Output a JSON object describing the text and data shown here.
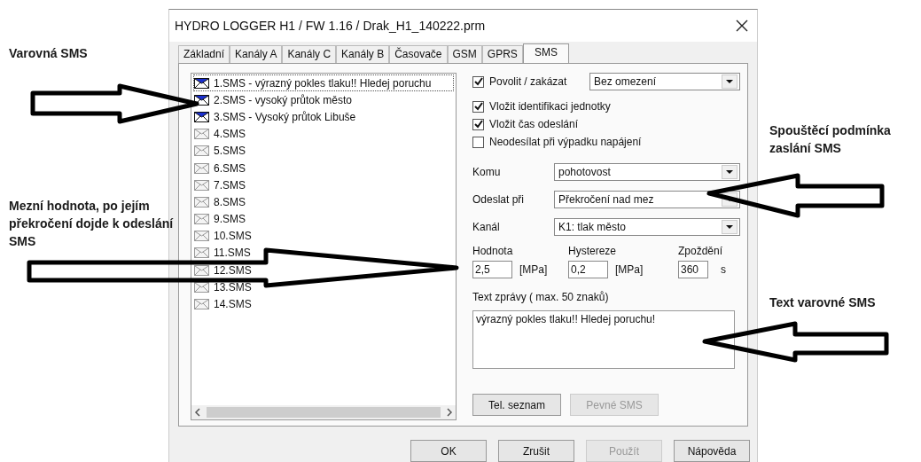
{
  "window": {
    "title": "HYDRO LOGGER H1 / FW 1.16 / Drak_H1_140222.prm"
  },
  "tabs": [
    {
      "label": "Základní",
      "selected": false
    },
    {
      "label": "Kanály A",
      "selected": false
    },
    {
      "label": "Kanály C",
      "selected": false
    },
    {
      "label": "Kanály B",
      "selected": false
    },
    {
      "label": "Časovače",
      "selected": false
    },
    {
      "label": "GSM",
      "selected": false
    },
    {
      "label": "GPRS",
      "selected": false
    },
    {
      "label": "SMS",
      "selected": true
    }
  ],
  "sms_list": [
    {
      "label": "1.SMS - výrazný pokles tlaku!! Hledej poruchu",
      "active": true,
      "selected": true
    },
    {
      "label": "2.SMS - vysoký průtok město",
      "active": true,
      "selected": false
    },
    {
      "label": "3.SMS -  Vysoký průtok Libuše",
      "active": true,
      "selected": false
    },
    {
      "label": "4.SMS",
      "active": false,
      "selected": false
    },
    {
      "label": "5.SMS",
      "active": false,
      "selected": false
    },
    {
      "label": "6.SMS",
      "active": false,
      "selected": false
    },
    {
      "label": "7.SMS",
      "active": false,
      "selected": false
    },
    {
      "label": "8.SMS",
      "active": false,
      "selected": false
    },
    {
      "label": "9.SMS",
      "active": false,
      "selected": false
    },
    {
      "label": "10.SMS",
      "active": false,
      "selected": false
    },
    {
      "label": "11.SMS",
      "active": false,
      "selected": false
    },
    {
      "label": "12.SMS",
      "active": false,
      "selected": false
    },
    {
      "label": "13.SMS",
      "active": false,
      "selected": false
    },
    {
      "label": "14.SMS",
      "active": false,
      "selected": false
    }
  ],
  "enable": {
    "label": "Povolit / zakázat",
    "checked": true,
    "value": "Bez omezení"
  },
  "options": [
    {
      "label": "Vložit identifikaci jednotky",
      "checked": true
    },
    {
      "label": "Vložit čas odeslání",
      "checked": true
    },
    {
      "label": "Neodesílat při výpadku napájení",
      "checked": false
    }
  ],
  "selects": [
    {
      "label": "Komu",
      "value": "pohotovost"
    },
    {
      "label": "Odeslat při",
      "value": "Překročení nad mez"
    },
    {
      "label": "Kanál",
      "value": "K1: tlak město"
    }
  ],
  "values": [
    {
      "label": "Hodnota",
      "value": "2,5",
      "unit": "[MPa]"
    },
    {
      "label": "Hystereze",
      "value": "0,2",
      "unit": "[MPa]"
    },
    {
      "label": "Zpoždění",
      "value": "360",
      "unit": "s"
    }
  ],
  "message": {
    "label": "Text zprávy ( max. 50 znaků)",
    "value": "výrazný pokles tlaku!! Hledej poruchu!"
  },
  "panel_buttons": [
    {
      "label": "Tel. seznam",
      "disabled": false
    },
    {
      "label": "Pevné SMS",
      "disabled": true
    }
  ],
  "dialog_buttons": [
    {
      "label": "OK",
      "disabled": false
    },
    {
      "label": "Zrušit",
      "disabled": false
    },
    {
      "label": "Použít",
      "disabled": true
    },
    {
      "label": "Nápověda",
      "disabled": false
    }
  ],
  "annotations": [
    "Varovná SMS",
    "Mezní hodnota, po jejím překročení dojde k odeslání SMS",
    "Spouštěcí podmínka zaslání SMS",
    "Text varovné SMS"
  ]
}
